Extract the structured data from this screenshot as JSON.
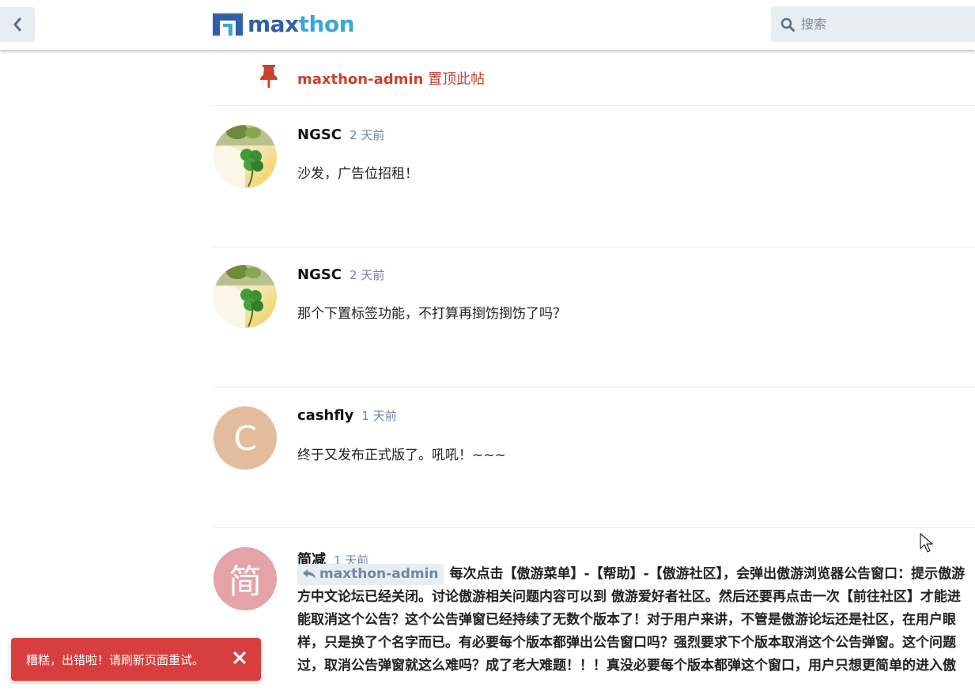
{
  "header": {
    "logo_text_main": "max",
    "logo_text_accent": "thon",
    "search": {
      "placeholder": "搜索",
      "value": ""
    }
  },
  "event": {
    "user": "maxthon-admin",
    "action": "置顶此帖"
  },
  "posts": [
    {
      "username": "NGSC",
      "time": "2 天前",
      "avatar_type": "image",
      "body": "沙发，广告位招租！"
    },
    {
      "username": "NGSC",
      "time": "2 天前",
      "avatar_type": "image",
      "body": "那个下置标签功能，不打算再捯饬捯饬了吗？"
    },
    {
      "username": "cashfly",
      "time": "1 天前",
      "avatar_letter": "C",
      "avatar_color": "#e2bc9d",
      "body": "终于又发布正式版了。吼吼！~~~"
    },
    {
      "username": "简减",
      "time": "1 天前",
      "avatar_letter": "简",
      "avatar_color": "#e4a3a6",
      "reply_to": "maxthon-admin",
      "body_lines": [
        "每次点击【傲游菜单】-【帮助】-【傲游社区】，会弹出傲游浏览器公告窗口：提示傲游",
        "方中文论坛已经关闭。讨论傲游相关问题内容可以到 傲游爱好者社区。然后还要再点击一次【前往社区】才能进",
        "能取消这个公告？这个公告弹窗已经持续了无数个版本了！对于用户来讲，不管是傲游论坛还是社区，在用户眼",
        "样，只是换了个名字而已。有必要每个版本都弹出公告窗口吗？强烈要求下个版本取消这个公告弹窗。这个问题",
        "过，取消公告弹窗就这么难吗？成了老大难题！！！真没必要每个版本都弹这个窗口，用户只想更简单的进入傲"
      ]
    }
  ],
  "toast": {
    "message": "糟糕，出错啦！请刷新页面重试。",
    "color": "#d83e3e"
  },
  "colors": {
    "accent_red": "#c9412f",
    "meta_blue": "#6f86a3",
    "chip_bg": "#e7edf3"
  }
}
